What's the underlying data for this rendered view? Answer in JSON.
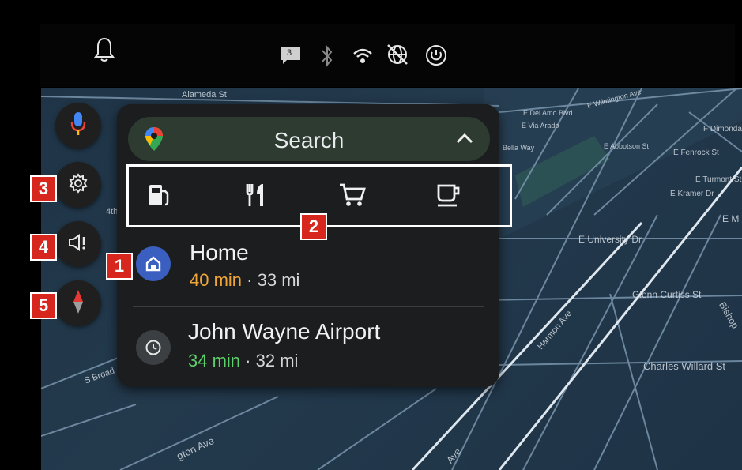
{
  "status_bar": {
    "icons": [
      "bell-icon",
      "message-icon",
      "bluetooth-icon",
      "wifi-icon",
      "no-network-icon",
      "power-icon"
    ],
    "message_count": "3"
  },
  "side_rail": {
    "buttons": [
      "microphone-icon",
      "settings-gear-icon",
      "report-incident-icon",
      "compass-icon"
    ]
  },
  "search": {
    "label": "Search",
    "logo": "google-maps-pin-icon",
    "collapse_icon": "chevron-up-icon"
  },
  "categories": [
    "gas-station-icon",
    "restaurant-icon",
    "shopping-cart-icon",
    "coffee-icon"
  ],
  "destinations": [
    {
      "title": "Home",
      "time": "40 min",
      "separator": "·",
      "distance": "33 mi",
      "time_color": "#f0a53a",
      "icon": "home-icon"
    },
    {
      "title": "John Wayne Airport",
      "time": "34 min",
      "separator": "·",
      "distance": "32 mi",
      "time_color": "#5fcf6b",
      "icon": "history-clock-icon"
    }
  ],
  "map_labels": {
    "alameda": "Alameda St",
    "del_amo": "E Del Amo Blvd",
    "wilmington": "E Wilmington Ave",
    "via_arado": "E Via Arado",
    "bella_way": "Bella Way",
    "dimondale": "F Dimondal",
    "abbotson": "E Abbotson St",
    "fenrock": "E Fenrock St",
    "turmont": "E Turmont St",
    "kramer": "E Kramer Dr",
    "university": "E University Dr",
    "glenn_curtiss": "Glenn Curtiss St",
    "charles_willard": "Charles Willard St",
    "harmon": "Harmon Ave",
    "bishop": "Bishop",
    "broad": "S Broad",
    "ave_bottom": "Ave",
    "gton_ave": "gton Ave",
    "fourth": "4th",
    "em": "E M"
  },
  "callouts": [
    "1",
    "2",
    "3",
    "4",
    "5"
  ],
  "colors": {
    "panel": "#1b1d1f",
    "search_bar": "#2d3b31",
    "map": "#23394c",
    "callout": "#d6261e",
    "home_icon_bg": "#3b5fc0",
    "clock_icon_bg": "#3b3f42"
  }
}
